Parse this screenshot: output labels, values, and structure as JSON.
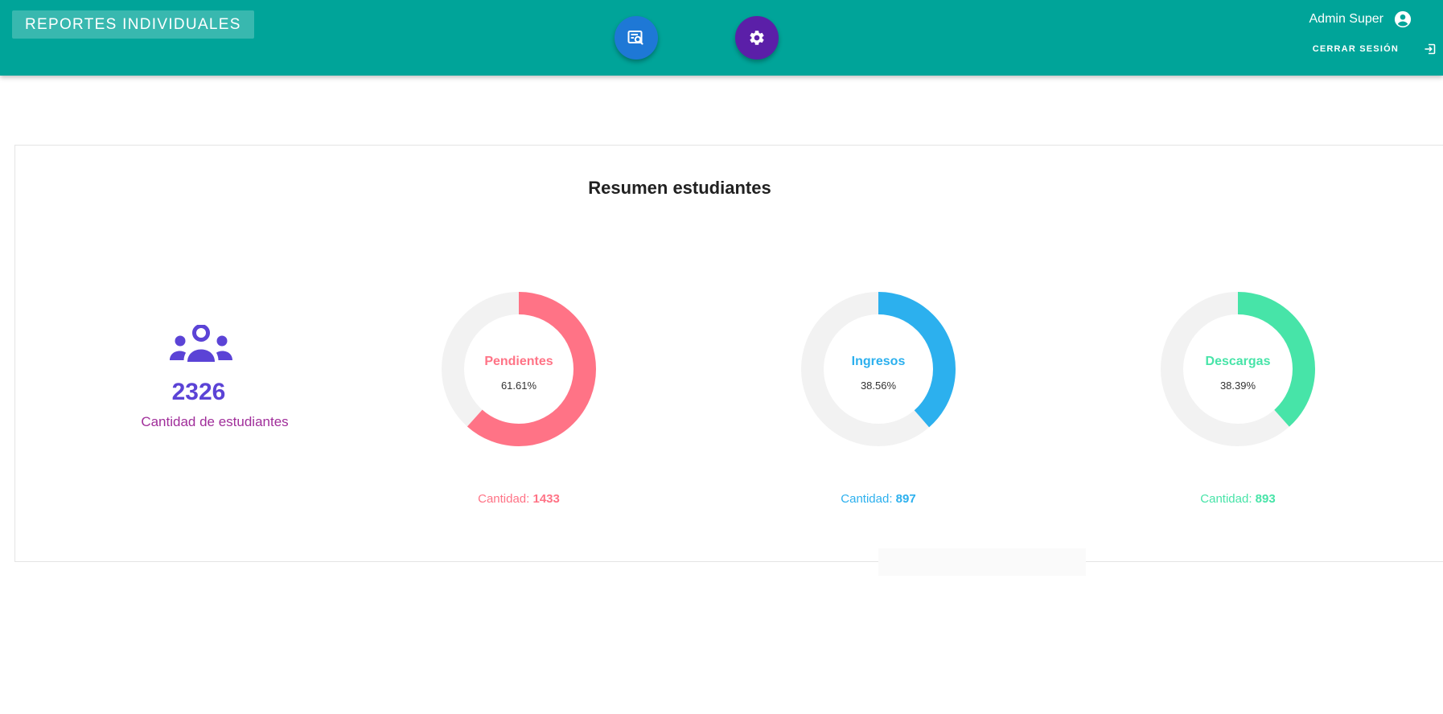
{
  "header": {
    "title": "REPORTES INDIVIDUALES",
    "user_name": "Admin Super",
    "logout_label": "CERRAR SESIÓN",
    "color": "#00a499"
  },
  "actions": [
    {
      "name": "report-search-button",
      "icon": "report-search-icon",
      "color": "#1e78d6"
    },
    {
      "name": "settings-button",
      "icon": "gear-icon",
      "color": "#5b1fa8"
    }
  ],
  "summary": {
    "title": "Resumen estudiantes",
    "students": {
      "count": "2326",
      "label": "Cantidad de estudiantes",
      "icon": "users-group-icon"
    }
  },
  "chart_data": [
    {
      "type": "pie",
      "label": "Pendientes",
      "percent": 61.61,
      "percent_text": "61.61%",
      "qty_label": "Cantidad:",
      "qty_value": "1433",
      "color": "#ff7386"
    },
    {
      "type": "pie",
      "label": "Ingresos",
      "percent": 38.56,
      "percent_text": "38.56%",
      "qty_label": "Cantidad:",
      "qty_value": "897",
      "color": "#2cb0ee"
    },
    {
      "type": "pie",
      "label": "Descargas",
      "percent": 38.39,
      "percent_text": "38.39%",
      "qty_label": "Cantidad:",
      "qty_value": "893",
      "color": "#47e4a8"
    }
  ]
}
